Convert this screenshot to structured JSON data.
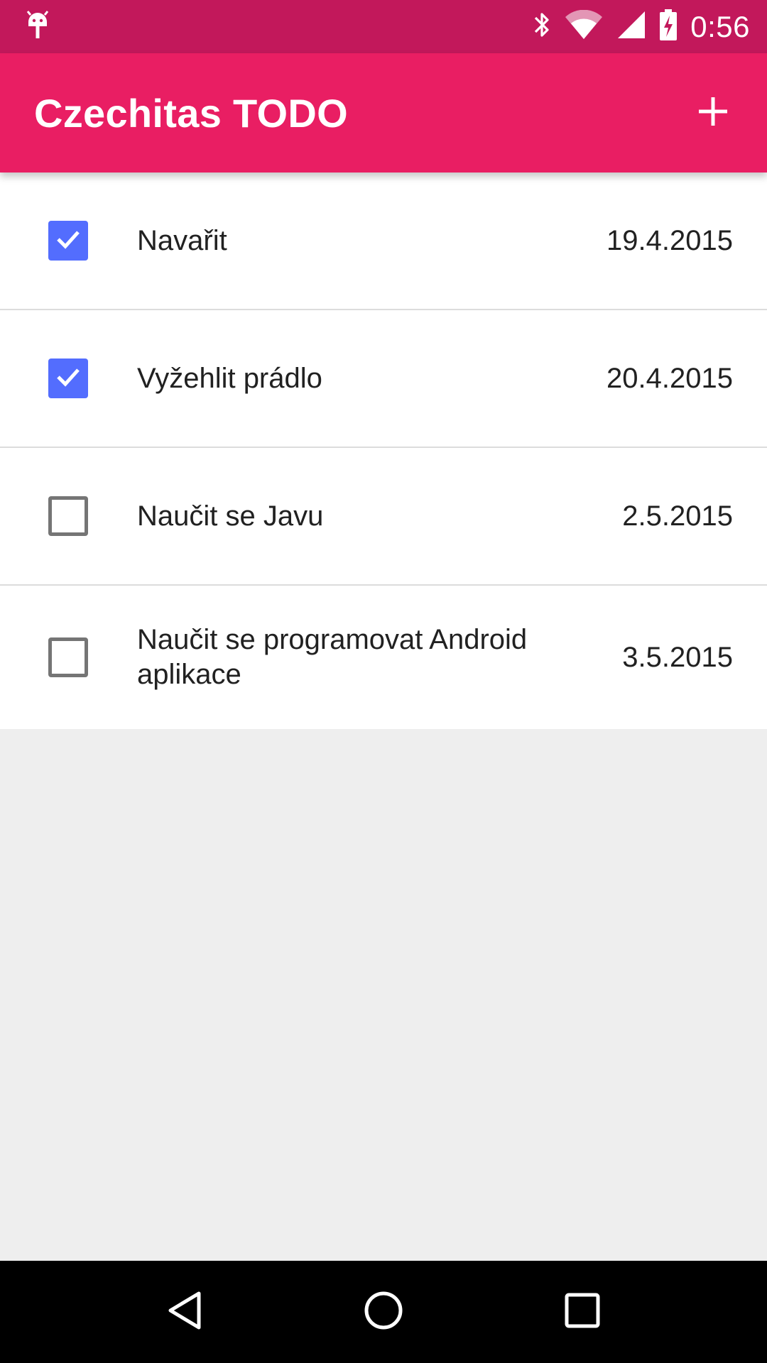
{
  "status_bar": {
    "time": "0:56",
    "icons": [
      "android-debug-icon",
      "bluetooth-icon",
      "wifi-icon",
      "signal-icon",
      "battery-charging-icon"
    ]
  },
  "app_bar": {
    "title": "Czechitas TODO",
    "action_icon": "add-icon"
  },
  "todos": [
    {
      "label": "Navařit",
      "date": "19.4.2015",
      "checked": true
    },
    {
      "label": "Vyžehlit prádlo",
      "date": "20.4.2015",
      "checked": true
    },
    {
      "label": "Naučit se Javu",
      "date": "2.5.2015",
      "checked": false
    },
    {
      "label": "Naučit se programovat Android aplikace",
      "date": "3.5.2015",
      "checked": false
    }
  ],
  "nav_bar": {
    "icons": [
      "back-icon",
      "home-icon",
      "recents-icon"
    ]
  },
  "colors": {
    "status_bar": "#c2185b",
    "app_bar": "#e91e63",
    "checkbox_checked": "#536dfe",
    "background": "#eeeeee"
  }
}
